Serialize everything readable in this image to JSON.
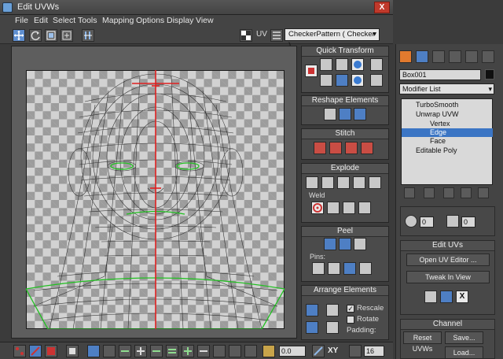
{
  "window": {
    "title": "Edit UVWs",
    "close_glyph": "X"
  },
  "menu": [
    "File",
    "Edit",
    "Select",
    "Tools",
    "Mapping",
    "Options",
    "Display",
    "View"
  ],
  "toolbar": {
    "uv_label": "UV",
    "texture_select": "CheckerPattern  ( Checker )"
  },
  "rollouts": {
    "quick_transform": "Quick Transform",
    "reshape": "Reshape Elements",
    "stitch": "Stitch",
    "explode": "Explode",
    "weld": "Weld",
    "peel": "Peel",
    "pins": "Pins:",
    "arrange": "Arrange Elements",
    "rescale": "Rescale",
    "rotate": "Rotate",
    "padding": "Padding:"
  },
  "bottom": {
    "value1": "0.0",
    "xy_label": "XY",
    "value2": "16"
  },
  "command_panel": {
    "object_name": "Box001",
    "modifier_list": "Modifier List",
    "stack": [
      {
        "label": "TurboSmooth",
        "indent": 1
      },
      {
        "label": "Unwrap UVW",
        "indent": 1
      },
      {
        "label": "Vertex",
        "indent": 2
      },
      {
        "label": "Edge",
        "indent": 2,
        "selected": true
      },
      {
        "label": "Face",
        "indent": 2
      },
      {
        "label": "Editable Poly",
        "indent": 0
      }
    ],
    "spin_a": "0",
    "spin_b": "0",
    "edit_uvs": "Edit UVs",
    "open_uv_editor": "Open UV Editor ...",
    "tweak_in_view": "Tweak In View",
    "channel": "Channel",
    "reset_uvws": "Reset UVWs",
    "save": "Save...",
    "load": "Load..."
  },
  "colors": {
    "accent": "#4e7fc4",
    "selected": "#3b75c4",
    "seam": "#e02020",
    "selection_edges": "#22c022"
  }
}
